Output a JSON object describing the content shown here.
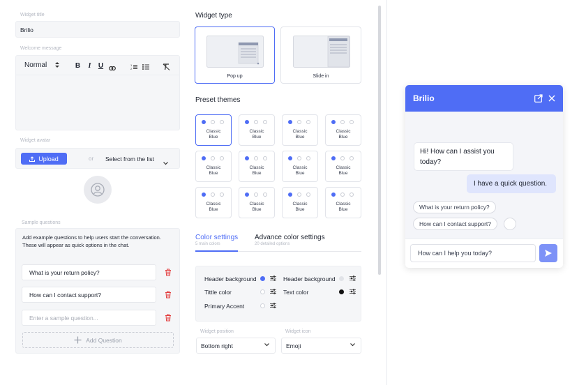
{
  "form": {
    "title_label": "Widget title",
    "title_value": "Brilio",
    "welcome_label": "Welcome message",
    "editor": {
      "format": "Normal",
      "bold": "B",
      "italic": "I",
      "underline": "U"
    },
    "avatar_label": "Widget avatar",
    "upload_label": "Upload",
    "or_label": "or",
    "select_list_label": "Select from the list",
    "sample_label": "Sample questions",
    "sample_desc": "Add example questions to help users start the conversation. These will appear as quick options in the chat.",
    "questions": [
      "What is your return policy?",
      "How can I contact support?"
    ],
    "question_placeholder": "Enter a sample question...",
    "add_question_label": "Add Question"
  },
  "widget_type": {
    "heading": "Widget type",
    "options": [
      {
        "label": "Pop up"
      },
      {
        "label": "Slide in"
      }
    ],
    "selected": "Pop up"
  },
  "themes": {
    "heading": "Preset themes",
    "items": [
      {
        "line1": "Classic",
        "line2": "Blue"
      },
      {
        "line1": "Classic",
        "line2": "Blue"
      },
      {
        "line1": "Classic",
        "line2": "Blue"
      },
      {
        "line1": "Classic",
        "line2": "Blue"
      },
      {
        "line1": "Classic",
        "line2": "Blue"
      },
      {
        "line1": "Classic",
        "line2": "Blue"
      },
      {
        "line1": "Classic",
        "line2": "Blue"
      },
      {
        "line1": "Classic",
        "line2": "Blue"
      },
      {
        "line1": "Classic",
        "line2": "Blue"
      },
      {
        "line1": "Classic",
        "line2": "Blue"
      },
      {
        "line1": "Classic",
        "line2": "Blue"
      },
      {
        "line1": "Classic",
        "line2": "Blue"
      }
    ]
  },
  "color_tabs": {
    "tab1": "Color settings",
    "tab1_sub": "5 main colors",
    "tab2": "Advance color settings",
    "tab2_sub": "20 detailed options"
  },
  "colors": {
    "header_bg": "Header background",
    "header_bg2": "Header background",
    "title_color": "Tittle color",
    "text_color": "Text color",
    "primary_accent": "Primary Accent"
  },
  "position": {
    "label": "Widget position",
    "value": "Bottom right"
  },
  "icon": {
    "label": "Widget icon",
    "value": "Emoji"
  },
  "chat": {
    "title": "Brilio",
    "bot_msg": "Hi! How can I assist you today?",
    "user_msg": "I have a quick question.",
    "chips": [
      "What is your return policy?",
      "How can I contact support?"
    ],
    "input_placeholder": "How can I help you today?"
  },
  "accent": "#4f6df5"
}
